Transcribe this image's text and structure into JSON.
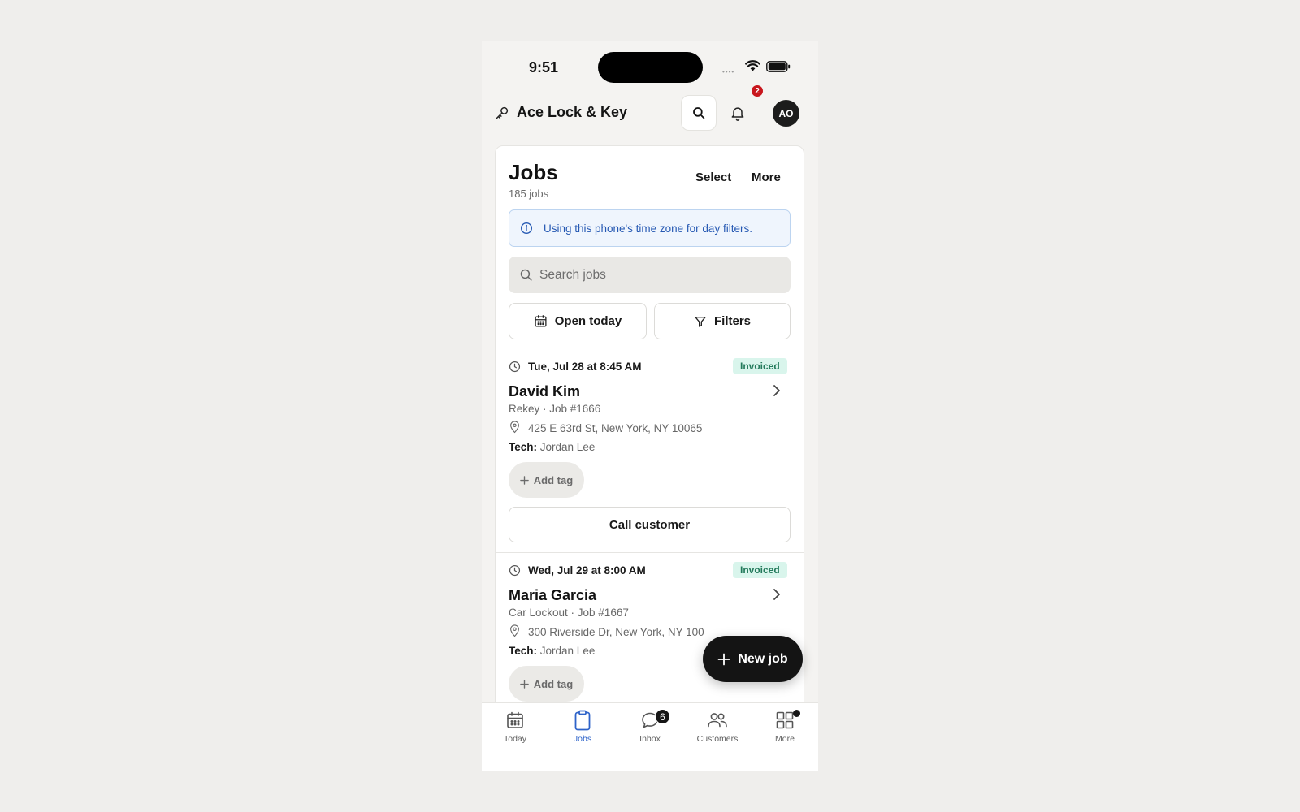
{
  "status_bar": {
    "time": "9:51",
    "cell_dots": "••••"
  },
  "header": {
    "brand_name": "Ace Lock & Key",
    "notification_count": "2",
    "avatar_initials": "AO"
  },
  "jobs_page": {
    "title": "Jobs",
    "count_label": "185 jobs",
    "select_label": "Select",
    "more_label": "More",
    "info_banner": "Using this phone's time zone for day filters.",
    "search_placeholder": "Search jobs",
    "search_value": "",
    "open_today_label": "Open today",
    "filters_label": "Filters"
  },
  "jobs": [
    {
      "date": "Tue, Jul 28 at 8:45 AM",
      "status": "Invoiced",
      "customer": "David Kim",
      "service": "Rekey · Job #1666",
      "address": "425 E 63rd St, New York, NY 10065",
      "tech_label": "Tech:",
      "tech_name": "Jordan Lee",
      "add_tag_label": "Add tag",
      "call_label": "Call customer"
    },
    {
      "date": "Wed, Jul 29 at 8:00 AM",
      "status": "Invoiced",
      "customer": "Maria Garcia",
      "service": "Car Lockout · Job #1667",
      "address": "300 Riverside Dr, New York, NY 100",
      "tech_label": "Tech:",
      "tech_name": "Jordan Lee",
      "add_tag_label": "Add tag"
    }
  ],
  "fab": {
    "label": "New job"
  },
  "tab_bar": {
    "items": [
      {
        "label": "Today",
        "icon": "calendar-icon"
      },
      {
        "label": "Jobs",
        "icon": "clipboard-icon",
        "active": true
      },
      {
        "label": "Inbox",
        "icon": "chat-bubble-icon",
        "badge": "6"
      },
      {
        "label": "Customers",
        "icon": "people-icon"
      },
      {
        "label": "More",
        "icon": "grid-icon"
      }
    ]
  },
  "colors": {
    "accent_blue": "#2e63c9",
    "info_text": "#2659b3",
    "status_invoiced_bg": "#d9f5ec",
    "status_invoiced_text": "#237a5b",
    "notification_badge": "#c8161d"
  }
}
